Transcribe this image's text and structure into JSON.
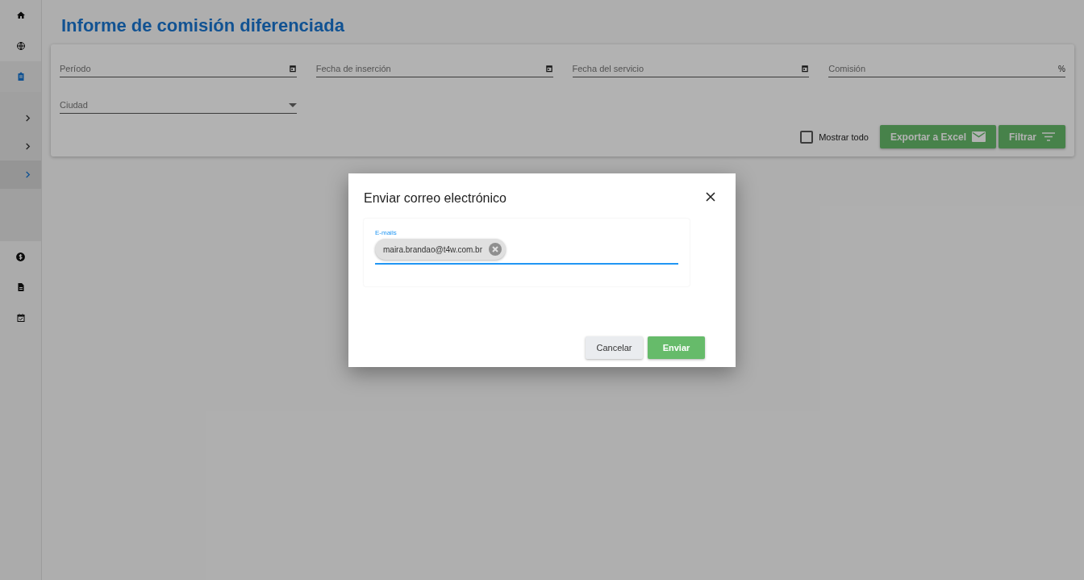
{
  "sidebar": {
    "items": [
      {
        "kind": "home",
        "selected": false
      },
      {
        "kind": "globe",
        "selected": false
      },
      {
        "kind": "clipboard",
        "selected": true,
        "expanded": true,
        "children": [
          {
            "selected": false
          },
          {
            "selected": false
          },
          {
            "selected": true
          }
        ]
      },
      {
        "kind": "dollar",
        "selected": false
      },
      {
        "kind": "document",
        "selected": false
      },
      {
        "kind": "calendar",
        "selected": false
      }
    ]
  },
  "page": {
    "title": "Informe de comisión diferenciada"
  },
  "filters": {
    "fields": [
      {
        "kind": "date",
        "label": "Período"
      },
      {
        "kind": "date",
        "label": "Fecha de inserción"
      },
      {
        "kind": "date",
        "label": "Fecha del servicio"
      },
      {
        "kind": "percent",
        "label": "Comisión",
        "suffix": "%"
      },
      {
        "kind": "select",
        "label": "Ciudad"
      }
    ],
    "show_all": {
      "label": "Mostrar todo",
      "checked": false
    },
    "buttons": [
      {
        "kind": "mail",
        "label": "Exportar a Excel"
      },
      {
        "kind": "filter",
        "label": "Filtrar"
      }
    ]
  },
  "dialog": {
    "title": "Enviar correo electrónico",
    "field_label": "E-mails",
    "chips": [
      "maira.brandao@t4w.com.br"
    ],
    "buttons": [
      {
        "kind": "secondary",
        "label": "Cancelar"
      },
      {
        "kind": "primary",
        "label": "Enviar"
      }
    ]
  }
}
